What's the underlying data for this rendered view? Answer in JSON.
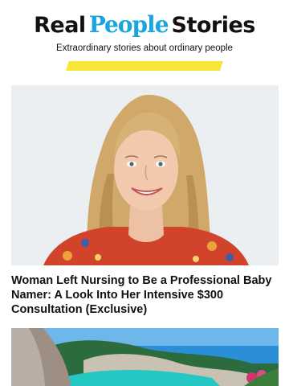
{
  "brand": {
    "left": "Real",
    "middle": "People",
    "right": "Stories",
    "tagline": "Extraordinary stories about ordinary people",
    "colors": {
      "accent": "#19a6de",
      "highlight": "#f7e53a"
    }
  },
  "articles": [
    {
      "headline": "Woman Left Nursing to Be a Professional Baby Namer: A Look Into Her Intensive $300 Consultation (Exclusive)"
    }
  ]
}
